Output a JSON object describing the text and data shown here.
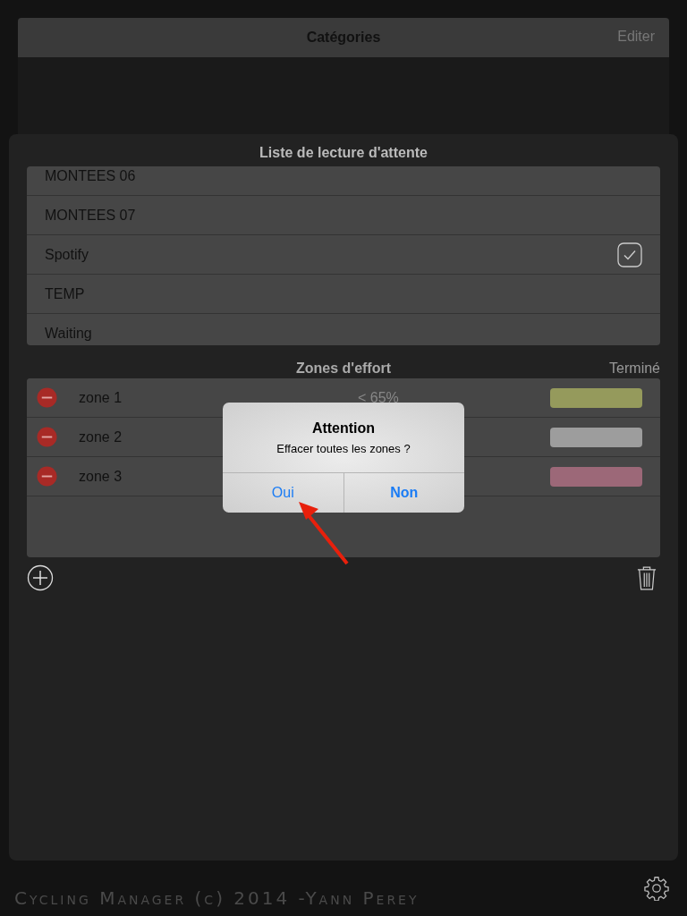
{
  "categories": {
    "title": "Catégories",
    "edit_button": "Editer"
  },
  "playlist": {
    "title": "Liste de lecture d'attente",
    "items": [
      {
        "label": "MONTEES 06",
        "checked": false
      },
      {
        "label": "MONTEES 07",
        "checked": false
      },
      {
        "label": "Spotify",
        "checked": true
      },
      {
        "label": "TEMP",
        "checked": false
      },
      {
        "label": "Waiting",
        "checked": false
      }
    ]
  },
  "zones": {
    "title": "Zones d'effort",
    "done_button": "Terminé",
    "rows": [
      {
        "name": "zone 1",
        "range": "< 65%",
        "color": "#959a5c"
      },
      {
        "name": "zone 2",
        "color": "#9d9d9d"
      },
      {
        "name": "zone 3",
        "color": "#9c6878"
      }
    ]
  },
  "alert": {
    "title": "Attention",
    "message": "Effacer toutes les zones ?",
    "buttons": [
      {
        "label": "Oui",
        "preferred": false
      },
      {
        "label": "Non",
        "preferred": true
      }
    ]
  },
  "footer": "Cycling Manager (c) 2014 -Yann Perey"
}
